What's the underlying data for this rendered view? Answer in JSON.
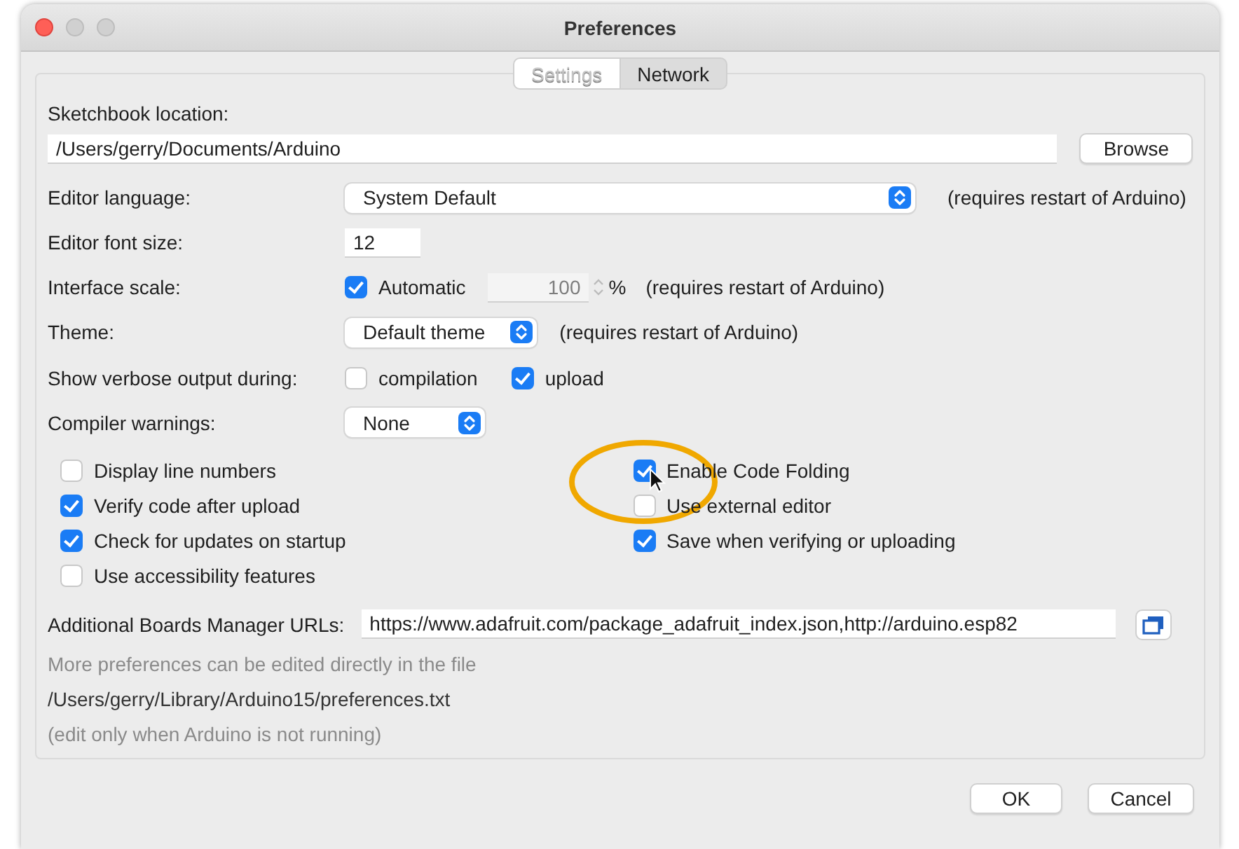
{
  "window": {
    "title": "Preferences"
  },
  "tabs": [
    {
      "label": "Settings",
      "selected": true
    },
    {
      "label": "Network",
      "selected": false
    }
  ],
  "sketchbook": {
    "label": "Sketchbook location:",
    "value": "/Users/gerry/Documents/Arduino",
    "button": "Browse"
  },
  "rows": [
    {
      "kind": "select",
      "label": "Editor language:",
      "value": "System Default",
      "note": "(requires restart of Arduino)"
    },
    {
      "kind": "text",
      "label": "Editor font size:",
      "value": "12"
    },
    {
      "kind": "scale",
      "label": "Interface scale:",
      "checkbox": {
        "label": "Automatic",
        "checked": true
      },
      "value": "100",
      "unit": "%",
      "note": "(requires restart of Arduino)"
    },
    {
      "kind": "select",
      "label": "Theme:",
      "value": "Default theme",
      "note": "(requires restart of Arduino)"
    },
    {
      "kind": "checks",
      "label": "Show verbose output during:",
      "options": [
        {
          "label": "compilation",
          "checked": false
        },
        {
          "label": "upload",
          "checked": true
        }
      ]
    },
    {
      "kind": "select",
      "label": "Compiler warnings:",
      "value": "None"
    }
  ],
  "left_options": [
    {
      "label": "Display line numbers",
      "checked": false
    },
    {
      "label": "Verify code after upload",
      "checked": true
    },
    {
      "label": "Check for updates on startup",
      "checked": true
    },
    {
      "label": "Use accessibility features",
      "checked": false
    }
  ],
  "right_options": [
    {
      "label": "Enable Code Folding",
      "checked": true
    },
    {
      "label": "Use external editor",
      "checked": false
    },
    {
      "label": "Save when verifying or uploading",
      "checked": true
    }
  ],
  "boards_urls": {
    "label": "Additional Boards Manager URLs:",
    "value": "https://www.adafruit.com/package_adafruit_index.json,http://arduino.esp82"
  },
  "info": {
    "line_1": "More preferences can be edited directly in the file",
    "path": "/Users/gerry/Library/Arduino15/preferences.txt",
    "line_3": "(edit only when Arduino is not running)"
  },
  "buttons": [
    "OK",
    "Cancel"
  ]
}
